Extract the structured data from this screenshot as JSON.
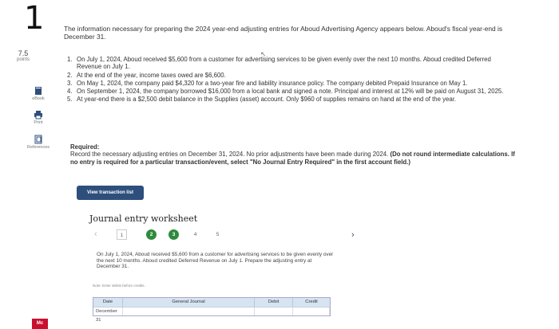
{
  "question_number": "1",
  "points": {
    "value": "7.5",
    "label": "points"
  },
  "sidebar": {
    "ebook": {
      "label": "eBook",
      "icon": "book-icon"
    },
    "print": {
      "label": "Print",
      "icon": "printer-icon"
    },
    "references": {
      "label": "References",
      "icon": "references-icon"
    }
  },
  "intro": "The information necessary for preparing the 2024 year-end adjusting entries for Aboud Advertising Agency appears below. Aboud's fiscal year-end is December 31.",
  "steps": [
    {
      "n": "1.",
      "text": "On July 1, 2024, Aboud received $5,600 from a customer for advertising services to be given evenly over the next 10 months. Aboud credited Deferred Revenue on July 1."
    },
    {
      "n": "2.",
      "text": "At the end of the year, income taxes owed are $6,600."
    },
    {
      "n": "3.",
      "text": "On May 1, 2024, the company paid $4,320 for a two-year fire and liability insurance policy. The company debited Prepaid Insurance on May 1."
    },
    {
      "n": "4.",
      "text": "On September 1, 2024, the company borrowed $16,000 from a local bank and signed a note. Principal and interest at 12% will be paid on August 31, 2025."
    },
    {
      "n": "5.",
      "text": "At year-end there is a $2,500 debit balance in the Supplies (asset) account. Only $960 of supplies remains on hand at the end of the year."
    }
  ],
  "required": {
    "heading": "Required:",
    "text": "Record the necessary adjusting entries on December 31, 2024. No prior adjustments have been made during 2024.",
    "bold": "(Do not round intermediate calculations. If no entry is required for a particular transaction/event, select \"No Journal Entry Required\" in the first account field.)"
  },
  "view_transaction_list_label": "View transaction list",
  "worksheet": {
    "title": "Journal entry worksheet",
    "steps": [
      "1",
      "2",
      "3",
      "4",
      "5"
    ],
    "current_step": "1",
    "completed_steps": [
      "2",
      "3"
    ],
    "description": "On July 1, 2024, Aboud received $5,600 from a customer for advertising services to be given evenly over the next 10 months. Aboud credited Deferred Revenue on July 1. Prepare the adjusting entry at December 31.",
    "note": "Note: Enter debits before credits.",
    "table": {
      "headers": {
        "date": "Date",
        "account": "General Journal",
        "debit": "Debit",
        "credit": "Credit"
      },
      "row": {
        "date": "December 31",
        "account": "",
        "debit": "",
        "credit": ""
      }
    }
  },
  "logo_text": "Mc"
}
